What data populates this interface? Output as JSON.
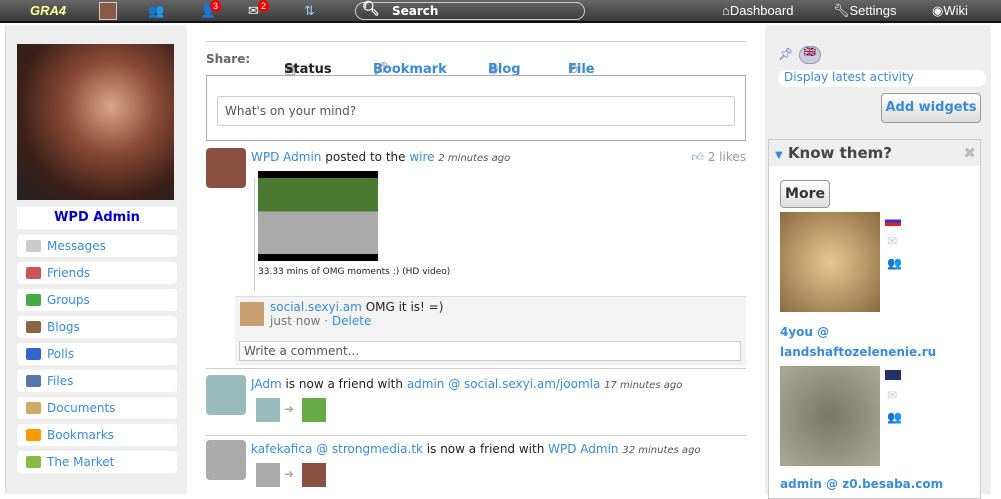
{
  "topbar": {
    "logo": "GRA4",
    "friend_requests_count": "3",
    "messages_count": "2",
    "search_label": "Search",
    "dashboard": "Dashboard",
    "settings": "Settings",
    "wiki": "Wiki"
  },
  "profile": {
    "name": "WPD Admin"
  },
  "sidebar": {
    "items": [
      {
        "label": "Messages",
        "color": "#ccc"
      },
      {
        "label": "Friends",
        "color": "#c55"
      },
      {
        "label": "Groups",
        "color": "#4a4"
      },
      {
        "label": "Blogs",
        "color": "#864"
      },
      {
        "label": "Polls",
        "color": "#36c"
      },
      {
        "label": "Files",
        "color": "#57a"
      },
      {
        "label": "Documents",
        "color": "#ca6"
      },
      {
        "label": "Bookmarks",
        "color": "#f90"
      },
      {
        "label": "The Market",
        "color": "#8b4"
      }
    ]
  },
  "share": {
    "label": "Share:",
    "tabs": [
      "Status",
      "Bookmark",
      "Blog",
      "File"
    ],
    "placeholder": "What's on your mind?"
  },
  "feed": {
    "post1": {
      "author": "WPD Admin",
      "verb": "posted to the",
      "target": "wire",
      "time": "2 minutes ago",
      "likes": "2 likes",
      "caption": "33.33 mins of OMG moments :) (HD video)",
      "comment": {
        "author": "social.sexyi.am",
        "text": "OMG it is! =)",
        "time": "just now",
        "delete": "Delete"
      },
      "comment_placeholder": "Write a comment..."
    },
    "post2": {
      "author": "JAdm",
      "verb": "is now a friend with",
      "target": "admin @ social.sexyi.am/joomla",
      "time": "17 minutes ago"
    },
    "post3": {
      "author": "kafekafica @ strongmedia.tk",
      "verb": "is now a friend with",
      "target": "WPD Admin",
      "time": "32 minutes ago"
    }
  },
  "right": {
    "display_latest": "Display latest activity",
    "add_widgets": "Add widgets",
    "widget_title": "Know them?",
    "more": "More",
    "people": [
      {
        "name": "4you @ landshaftozelenenie.ru"
      },
      {
        "name": "admin @ z0.besaba.com"
      }
    ]
  }
}
